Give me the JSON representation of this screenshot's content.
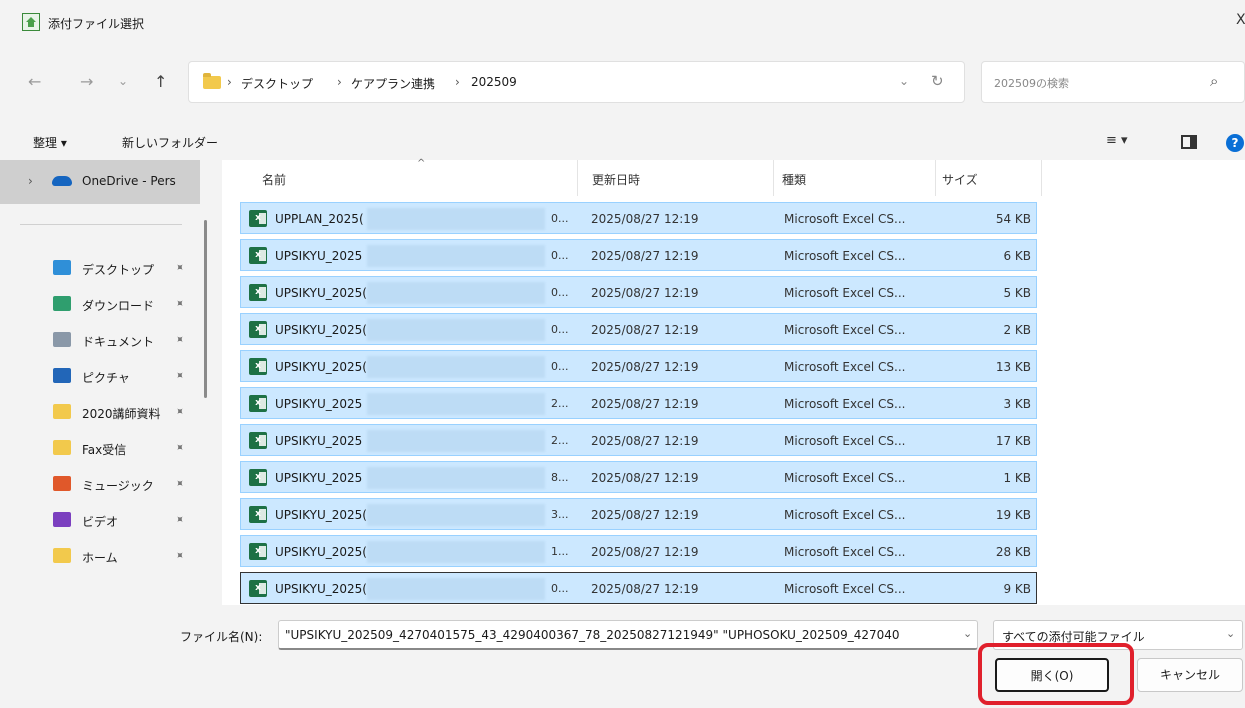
{
  "window": {
    "title": "添付ファイル選択",
    "close": "X"
  },
  "nav": {
    "back": "←",
    "forward": "→",
    "recent": "⌄",
    "up": "↑",
    "crumbs": [
      "デスクトップ",
      "ケアプラン連携",
      "202509"
    ],
    "separator": "›",
    "dropdown": "⌄",
    "refresh": "↻"
  },
  "search": {
    "placeholder": "202509の検索",
    "icon": "search-icon"
  },
  "commands": {
    "organize": "整理 ▾",
    "new_folder": "新しいフォルダー",
    "view": "≡ ▾",
    "help": "?"
  },
  "sidebar": {
    "onedrive": "OneDrive - Pers",
    "items": [
      {
        "label": "デスクトップ",
        "color": "#2f8fd8"
      },
      {
        "label": "ダウンロード",
        "color": "#2f9e6e"
      },
      {
        "label": "ドキュメント",
        "color": "#8a98a8"
      },
      {
        "label": "ピクチャ",
        "color": "#2266b8"
      },
      {
        "label": "2020講師資料",
        "color": "#f2c94c"
      },
      {
        "label": "Fax受信",
        "color": "#f2c94c"
      },
      {
        "label": "ミュージック",
        "color": "#e0582a"
      },
      {
        "label": "ビデオ",
        "color": "#7b3fbf"
      },
      {
        "label": "ホーム",
        "color": "#f2c94c"
      }
    ],
    "pin": "📌"
  },
  "columns": {
    "name": "名前",
    "modified": "更新日時",
    "type": "種類",
    "size": "サイズ",
    "sort": "^"
  },
  "files": [
    {
      "name": "UPPLAN_2025(",
      "tail": "0...",
      "date": "2025/08/27 12:19",
      "type": "Microsoft Excel CS...",
      "size": "54 KB"
    },
    {
      "name": "UPSIKYU_2025",
      "tail": "0...",
      "date": "2025/08/27 12:19",
      "type": "Microsoft Excel CS...",
      "size": "6 KB"
    },
    {
      "name": "UPSIKYU_2025(",
      "tail": "0...",
      "date": "2025/08/27 12:19",
      "type": "Microsoft Excel CS...",
      "size": "5 KB"
    },
    {
      "name": "UPSIKYU_2025(",
      "tail": "0...",
      "date": "2025/08/27 12:19",
      "type": "Microsoft Excel CS...",
      "size": "2 KB"
    },
    {
      "name": "UPSIKYU_2025(",
      "tail": "0...",
      "date": "2025/08/27 12:19",
      "type": "Microsoft Excel CS...",
      "size": "13 KB"
    },
    {
      "name": "UPSIKYU_2025",
      "tail": "2...",
      "date": "2025/08/27 12:19",
      "type": "Microsoft Excel CS...",
      "size": "3 KB"
    },
    {
      "name": "UPSIKYU_2025",
      "tail": "2...",
      "date": "2025/08/27 12:19",
      "type": "Microsoft Excel CS...",
      "size": "17 KB"
    },
    {
      "name": "UPSIKYU_2025",
      "tail": "8...",
      "date": "2025/08/27 12:19",
      "type": "Microsoft Excel CS...",
      "size": "1 KB"
    },
    {
      "name": "UPSIKYU_2025(",
      "tail": "3...",
      "date": "2025/08/27 12:19",
      "type": "Microsoft Excel CS...",
      "size": "19 KB"
    },
    {
      "name": "UPSIKYU_2025(",
      "tail": "1...",
      "date": "2025/08/27 12:19",
      "type": "Microsoft Excel CS...",
      "size": "28 KB"
    },
    {
      "name": "UPSIKYU_2025(",
      "tail": "0...",
      "date": "2025/08/27 12:19",
      "type": "Microsoft Excel CS...",
      "size": "9 KB"
    }
  ],
  "footer": {
    "filename_label": "ファイル名(N):",
    "filename_value": "\"UPSIKYU_202509_4270401575_43_4290400367_78_20250827121949\" \"UPHOSOKU_202509_427040",
    "filetype_value": "すべての添付可能ファイル",
    "open_label": "開く(O)",
    "cancel_label": "キャンセル",
    "highlight_color": "#e0202c"
  }
}
